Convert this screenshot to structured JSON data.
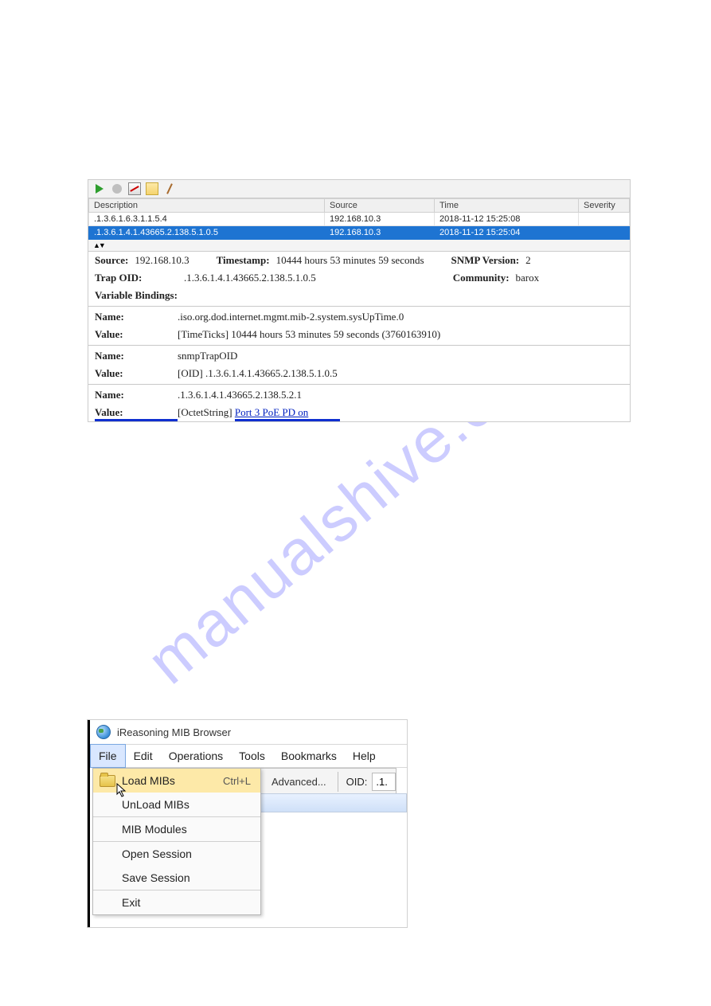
{
  "watermark": "manualshive.com",
  "trap": {
    "headers": {
      "desc": "Description",
      "src": "Source",
      "time": "Time",
      "sev": "Severity"
    },
    "rows": [
      {
        "desc": ".1.3.6.1.6.3.1.1.5.4",
        "src": "192.168.10.3",
        "time": "2018-11-12 15:25:08",
        "sev": ""
      },
      {
        "desc": ".1.3.6.1.4.1.43665.2.138.5.1.0.5",
        "src": "192.168.10.3",
        "time": "2018-11-12 15:25:04",
        "sev": ""
      }
    ],
    "detail": {
      "source_lbl": "Source:",
      "source": "192.168.10.3",
      "timestamp_lbl": "Timestamp:",
      "timestamp": "10444 hours 53 minutes 59 seconds",
      "snmpver_lbl": "SNMP Version:",
      "snmpver": "2",
      "trapoid_lbl": "Trap OID:",
      "trapoid": ".1.3.6.1.4.1.43665.2.138.5.1.0.5",
      "community_lbl": "Community:",
      "community": "barox",
      "varbind_lbl": "Variable Bindings:",
      "b1_name_lbl": "Name:",
      "b1_name": ".iso.org.dod.internet.mgmt.mib-2.system.sysUpTime.0",
      "b1_val_lbl": "Value:",
      "b1_val": "[TimeTicks] 10444 hours 53 minutes 59 seconds (3760163910)",
      "b2_name_lbl": "Name:",
      "b2_name": "snmpTrapOID",
      "b2_val_lbl": "Value:",
      "b2_val": "[OID] .1.3.6.1.4.1.43665.2.138.5.1.0.5",
      "b3_name_lbl": "Name:",
      "b3_name": ".1.3.6.1.4.1.43665.2.138.5.2.1",
      "b3_val_lbl": "Value:",
      "b3_val_pre": "[OctetString] ",
      "b3_val_link": "Port 3 PoE PD on"
    }
  },
  "mib": {
    "title": "iReasoning MIB Browser",
    "menus": {
      "file": "File",
      "edit": "Edit",
      "ops": "Operations",
      "tools": "Tools",
      "bm": "Bookmarks",
      "help": "Help"
    },
    "dropdown": {
      "load": "Load MIBs",
      "load_sc": "Ctrl+L",
      "unload": "UnLoad MIBs",
      "modules": "MIB Modules",
      "open": "Open Session",
      "save": "Save Session",
      "exit": "Exit"
    },
    "advanced": "Advanced...",
    "oid_lbl": "OID:",
    "oid_val": ".1."
  }
}
